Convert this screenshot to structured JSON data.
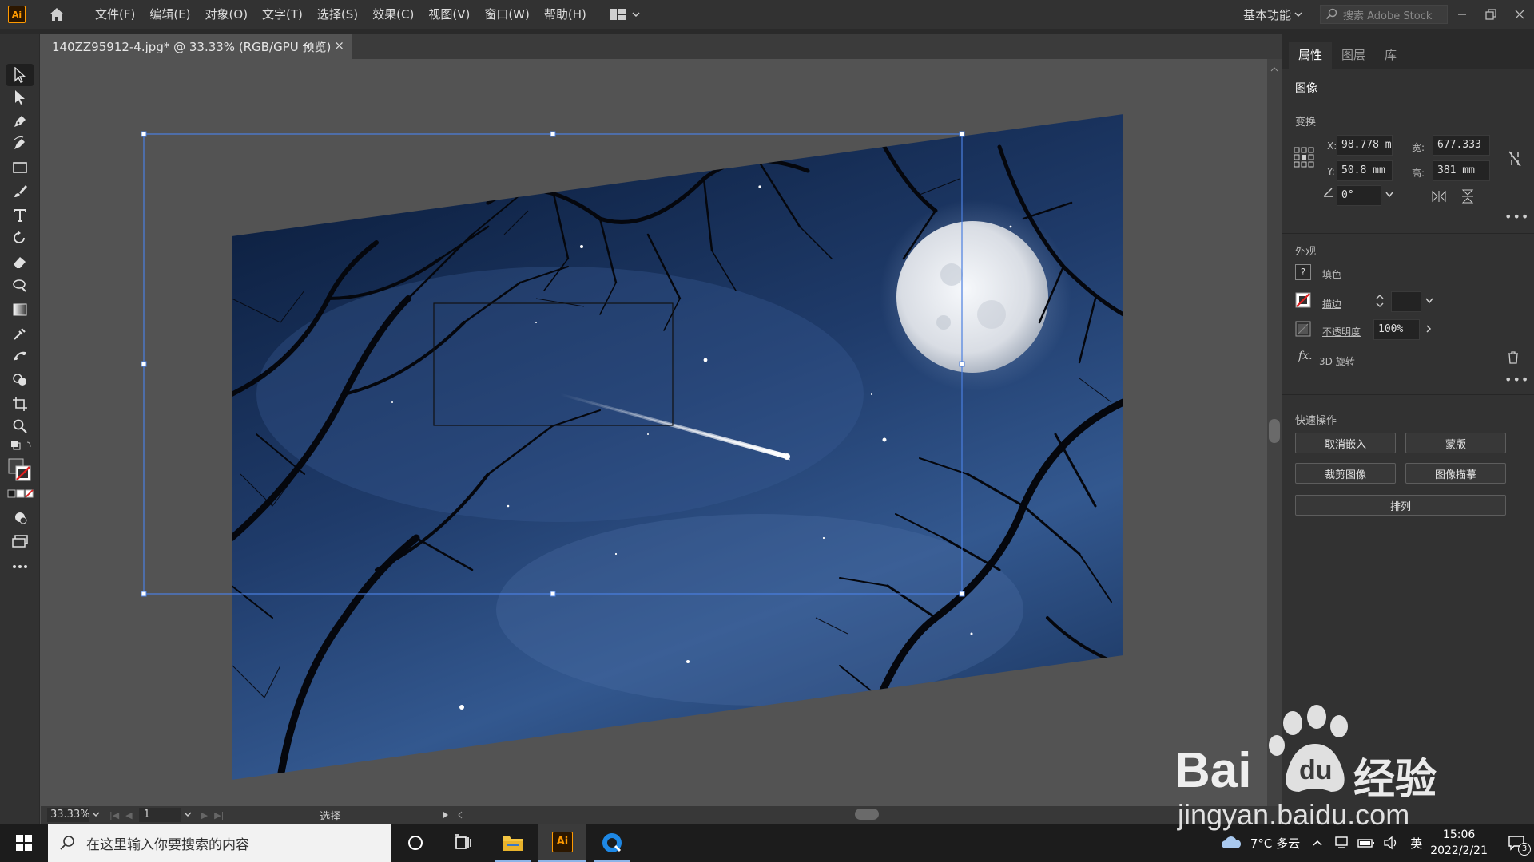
{
  "app": {
    "logo": "Ai",
    "menu": [
      "文件(F)",
      "编辑(E)",
      "对象(O)",
      "文字(T)",
      "选择(S)",
      "效果(C)",
      "视图(V)",
      "窗口(W)",
      "帮助(H)"
    ],
    "workspace_label": "基本功能",
    "stock_search_placeholder": "搜索 Adobe Stock"
  },
  "document": {
    "tab_title": "140ZZ95912-4.jpg* @ 33.33% (RGB/GPU 预览)",
    "close": "×"
  },
  "status": {
    "zoom": "33.33%",
    "page": "1",
    "tool_text": "选择"
  },
  "panel": {
    "tabs": [
      "属性",
      "图层",
      "库"
    ],
    "heading": "图像",
    "transform_title": "变换",
    "x_label": "X:",
    "x_value": "98.778 m",
    "y_label": "Y:",
    "y_value": "50.8 mm",
    "w_label": "宽:",
    "w_value": "677.333",
    "h_label": "高:",
    "h_value": "381 mm",
    "angle_value": "0°",
    "appearance_title": "外观",
    "fill_label": "填色",
    "stroke_label": "描边",
    "opacity_label": "不透明度",
    "opacity_value": "100%",
    "fx_label": "3D 旋转",
    "quick_title": "快速操作",
    "btn_unembed": "取消嵌入",
    "btn_mask": "蒙版",
    "btn_crop": "裁剪图像",
    "btn_trace": "图像描摹",
    "btn_arrange": "排列"
  },
  "taskbar": {
    "search_placeholder": "在这里输入你要搜索的内容",
    "weather": "7°C 多云",
    "ime": "英",
    "time": "15:06",
    "date": "2022/2/21",
    "notifications": "3"
  },
  "watermark": {
    "brand": "Bai",
    "brand2": "du",
    "brand_cn": "经验",
    "url": "jingyan.baidu.com"
  },
  "colors": {
    "accent": "#ff9a00",
    "selection": "#4a7fe0",
    "sky_top": "#0b1d3c",
    "sky_mid": "#33588f"
  }
}
